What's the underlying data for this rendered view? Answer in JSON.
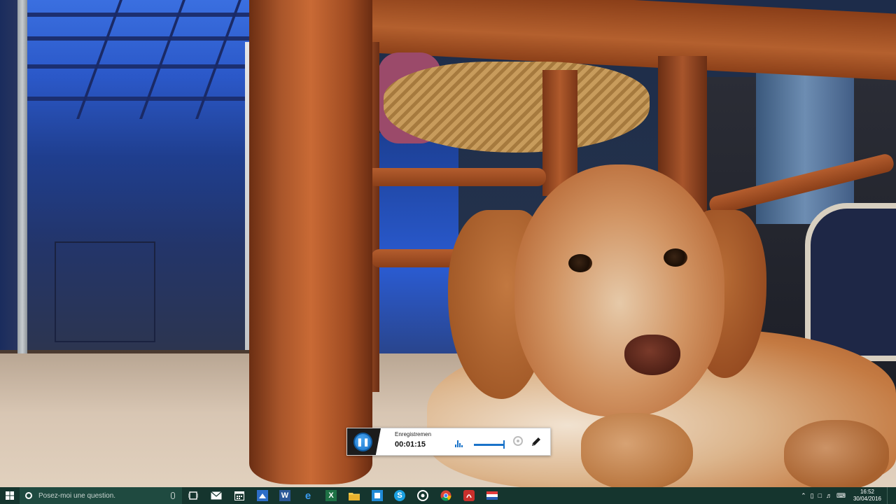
{
  "recorder": {
    "label": "Enregistremen",
    "elapsed": "00:01:15",
    "volume_level": 0.95
  },
  "taskbar": {
    "search_placeholder": "Posez-moi une question.",
    "pinned_icons": [
      "task-view-icon",
      "mail-icon",
      "calendar-icon",
      "presentation-icon",
      "word-icon",
      "edge-icon",
      "excel-icon",
      "file-explorer-icon",
      "store-icon",
      "skype-icon",
      "groove-icon",
      "chrome-icon",
      "music-app-icon",
      "flag-app-icon"
    ],
    "clock": {
      "time": "16:52",
      "date": "30/04/2016"
    }
  },
  "colors": {
    "taskbar_bg": "#15352e",
    "search_bg": "#1f4a40",
    "accent_blue": "#1a73c9"
  }
}
